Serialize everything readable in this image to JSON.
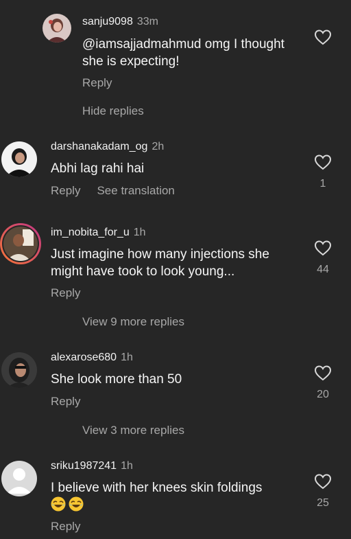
{
  "comments": [
    {
      "username": "sanju9098",
      "time": "33m",
      "text": "@iamsajjadmahmud  omg I thought she is expecting!",
      "reply_label": "Reply",
      "likes": ""
    },
    {
      "username": "darshanakadam_og",
      "time": "2h",
      "text": "Abhi lag rahi hai",
      "reply_label": "Reply",
      "translate_label": "See translation",
      "likes": "1"
    },
    {
      "username": "im_nobita_for_u",
      "time": "1h",
      "text": "Just imagine how many injections she might have took to look young...",
      "reply_label": "Reply",
      "likes": "44"
    },
    {
      "username": "alexarose680",
      "time": "1h",
      "text": "She look more than 50",
      "reply_label": "Reply",
      "likes": "20"
    },
    {
      "username": "sriku1987241",
      "time": "1h",
      "text": "I believe with her knees skin foldings",
      "emoji_count": 2,
      "reply_label": "Reply",
      "likes": "25"
    }
  ],
  "hide_replies_label": "Hide replies",
  "view_replies": [
    "View 9 more replies",
    "View 3 more replies"
  ],
  "colors": {
    "background": "#262626",
    "primary_text": "#f5f5f5",
    "secondary_text": "#a8a8a8",
    "story_ring_start": "#c13584",
    "story_ring_end": "#f77737"
  }
}
